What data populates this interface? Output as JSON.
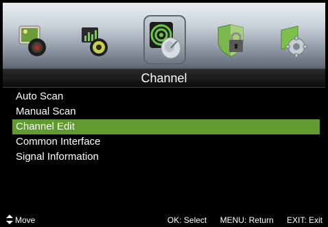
{
  "menu_icons": [
    {
      "name": "picture-icon"
    },
    {
      "name": "sound-icon"
    },
    {
      "name": "channel-icon",
      "selected": true
    },
    {
      "name": "lock-icon"
    },
    {
      "name": "setup-icon"
    }
  ],
  "title": "Channel",
  "menu": {
    "items": [
      {
        "label": "Auto Scan",
        "selected": false
      },
      {
        "label": "Manual Scan",
        "selected": false
      },
      {
        "label": "Channel Edit",
        "selected": true
      },
      {
        "label": "Common Interface",
        "selected": false
      },
      {
        "label": "Signal Information",
        "selected": false
      }
    ]
  },
  "footer": {
    "move_label": "Move",
    "hints": [
      "OK: Select",
      "MENU: Return",
      "EXIT: Exit"
    ]
  },
  "colors": {
    "selection": "#5f9b2f",
    "background": "#000000",
    "text": "#ffffff"
  }
}
